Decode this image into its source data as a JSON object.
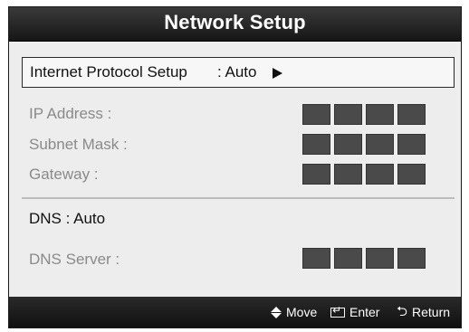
{
  "title": "Network Setup",
  "protocol": {
    "label": "Internet Protocol Setup",
    "value": ": Auto"
  },
  "fields": [
    {
      "label": "IP Address   :"
    },
    {
      "label": "Subnet Mask   :"
    },
    {
      "label": "Gateway   :"
    }
  ],
  "dns": {
    "label": "DNS   : Auto",
    "server_label": "DNS Server   :"
  },
  "footer": {
    "move": "Move",
    "enter": "Enter",
    "return": "Return"
  },
  "colors": {
    "titlebar": "#1e1e1e",
    "content": "#ededed",
    "box": "#4a4a4a",
    "disabled_text": "#8a8a8a"
  },
  "icons": [
    "arrow-right-icon",
    "move-icon",
    "enter-icon",
    "return-icon"
  ]
}
